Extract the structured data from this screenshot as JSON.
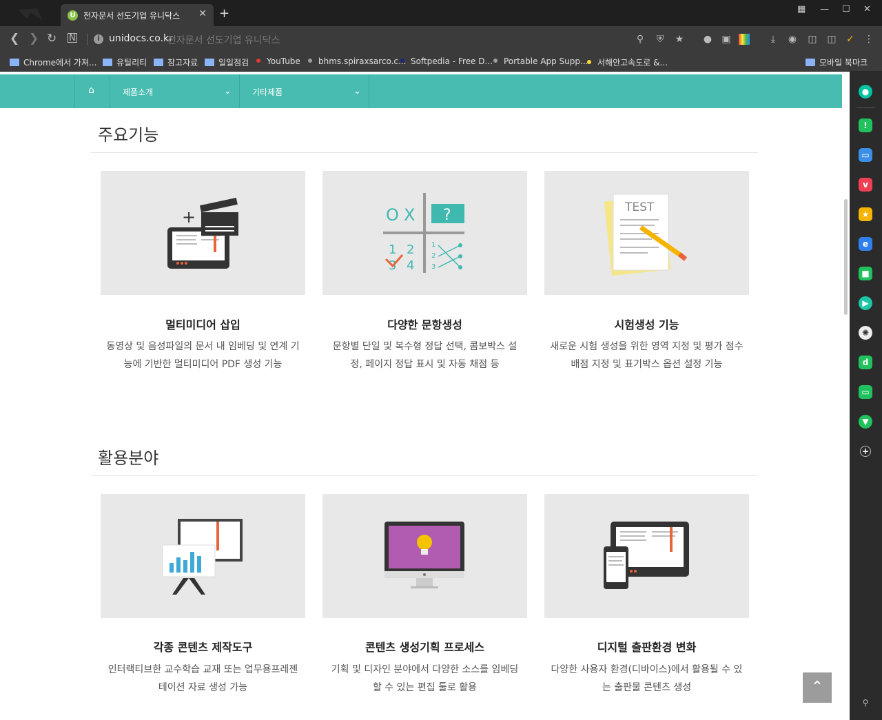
{
  "browser": {
    "tab_title": "전자문서 선도기업 유니닥스",
    "tab_favicon": "U",
    "url": "unidocs.co.kr",
    "url_title": "전자문서 선도기업 유니닥스"
  },
  "bookmarks": [
    {
      "label": "Chrome에서 가져...",
      "kind": "folder"
    },
    {
      "label": "유틸리티",
      "kind": "folder"
    },
    {
      "label": "참고자료",
      "kind": "folder"
    },
    {
      "label": "일일점검",
      "kind": "folder"
    },
    {
      "label": "YouTube",
      "kind": "site",
      "color": "#e53935"
    },
    {
      "label": "bhms.spiraxsarco.c...",
      "kind": "site",
      "color": "#9e9e9e"
    },
    {
      "label": "Softpedia - Free D...",
      "kind": "site",
      "color": "#1a237e"
    },
    {
      "label": "Portable App Supp...",
      "kind": "site",
      "color": "#9e9e9e"
    },
    {
      "label": "서해안고속도로 &...",
      "kind": "site",
      "color": "#fdd835"
    },
    {
      "label": "모바일 북마크",
      "kind": "folder"
    }
  ],
  "nav": {
    "home_icon": "home-icon",
    "items": [
      {
        "label": "제품소개"
      },
      {
        "label": "기타제품"
      }
    ],
    "color": "#48bcb0"
  },
  "features": {
    "title": "주요기능",
    "cards": [
      {
        "icon": "video-tablet-icon",
        "title": "멀티미디어 삽입",
        "desc1": "동영상 및 음성파일의 문서 내 임베딩 및 연계 기",
        "desc2": "능에 기반한 멀티미디어 PDF 생성 기능"
      },
      {
        "icon": "quiz-ox-icon",
        "title": "다양한 문항생성",
        "desc1": "문항별 단일 및 복수형 정답 선택, 콤보박스 설",
        "desc2": "정, 페이지 정답 표시 및 자동 채점 등",
        "quiz": {
          "o": "O",
          "x": "X",
          "q": "?",
          "n1": "1",
          "n2": "2",
          "n3": "3",
          "n4": "4",
          "s1": "1",
          "s2": "2",
          "s3": "3"
        }
      },
      {
        "icon": "test-paper-icon",
        "title": "시험생성 기능",
        "desc1": "새로운 시험 생성을 위한 영역 지정 및 평가 점수",
        "desc2": "배점 지정 및 표기박스 옵션 설정 기능",
        "paper_label": "TEST"
      }
    ]
  },
  "usage": {
    "title": "활용분야",
    "cards": [
      {
        "icon": "presentation-icon",
        "title": "각종 콘텐츠 제작도구",
        "desc1": "인터랙티브한 교수학습 교재 또는 업무용프레젠",
        "desc2": "테이션 자료 생성 가능"
      },
      {
        "icon": "monitor-idea-icon",
        "title": "콘텐츠 생성기획 프로세스",
        "desc1": "기획 및 디자인 분야에서 다양한 소스를 임베딩",
        "desc2": "할 수 있는 편집 툴로 활용"
      },
      {
        "icon": "devices-icon",
        "title": "디지털 출판환경 변화",
        "desc1": "다양한 사용자 환경(디바이스)에서 활용될 수 있",
        "desc2": "는 출판물 콘텐츠 생성"
      }
    ]
  },
  "sidebar_icons": [
    {
      "name": "whale-icon",
      "color": "#00c4a0"
    },
    {
      "name": "alarm-icon",
      "color": "#21c25e"
    },
    {
      "name": "calendar-icon",
      "color": "#3b8fe6"
    },
    {
      "name": "pocket-icon",
      "color": "#ef4056"
    },
    {
      "name": "favorite-icon",
      "color": "#f5b400"
    },
    {
      "name": "translate-icon",
      "color": "#2f80ed"
    },
    {
      "name": "note-icon",
      "color": "#21c25e"
    },
    {
      "name": "play-icon",
      "color": "#1ec6a8"
    },
    {
      "name": "openai-icon",
      "color": "#eeeeee"
    },
    {
      "name": "dict-icon",
      "color": "#21c25e"
    },
    {
      "name": "talk-icon",
      "color": "#21c25e"
    },
    {
      "name": "bookmark-icon",
      "color": "#21c25e"
    },
    {
      "name": "add-icon",
      "color": "#555555"
    }
  ]
}
